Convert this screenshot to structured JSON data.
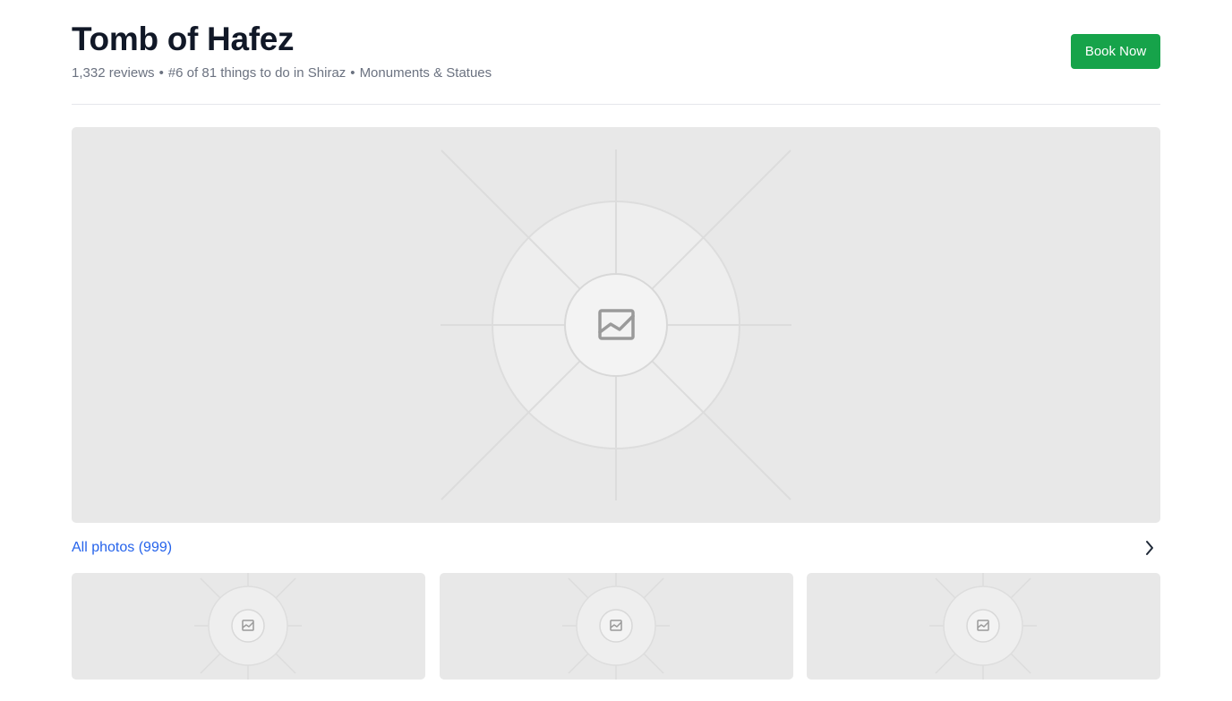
{
  "header": {
    "title": "Tomb of Hafez",
    "reviews": "1,332 reviews",
    "separator": "•",
    "rank": "#6 of 81 things to do in Shiraz",
    "category": "Monuments & Statues",
    "book_label": "Book Now"
  },
  "gallery": {
    "hero_icon": "image-placeholder-icon",
    "all_photos_label": "All photos (999)",
    "chevron_icon": "chevron-right-icon",
    "thumbnail_icon": "image-placeholder-icon",
    "thumbnail_count": 3
  },
  "colors": {
    "accent": "#16a34a",
    "link": "#2563eb",
    "placeholder_bg": "#e8e8e8",
    "muted_text": "#6b7280"
  }
}
